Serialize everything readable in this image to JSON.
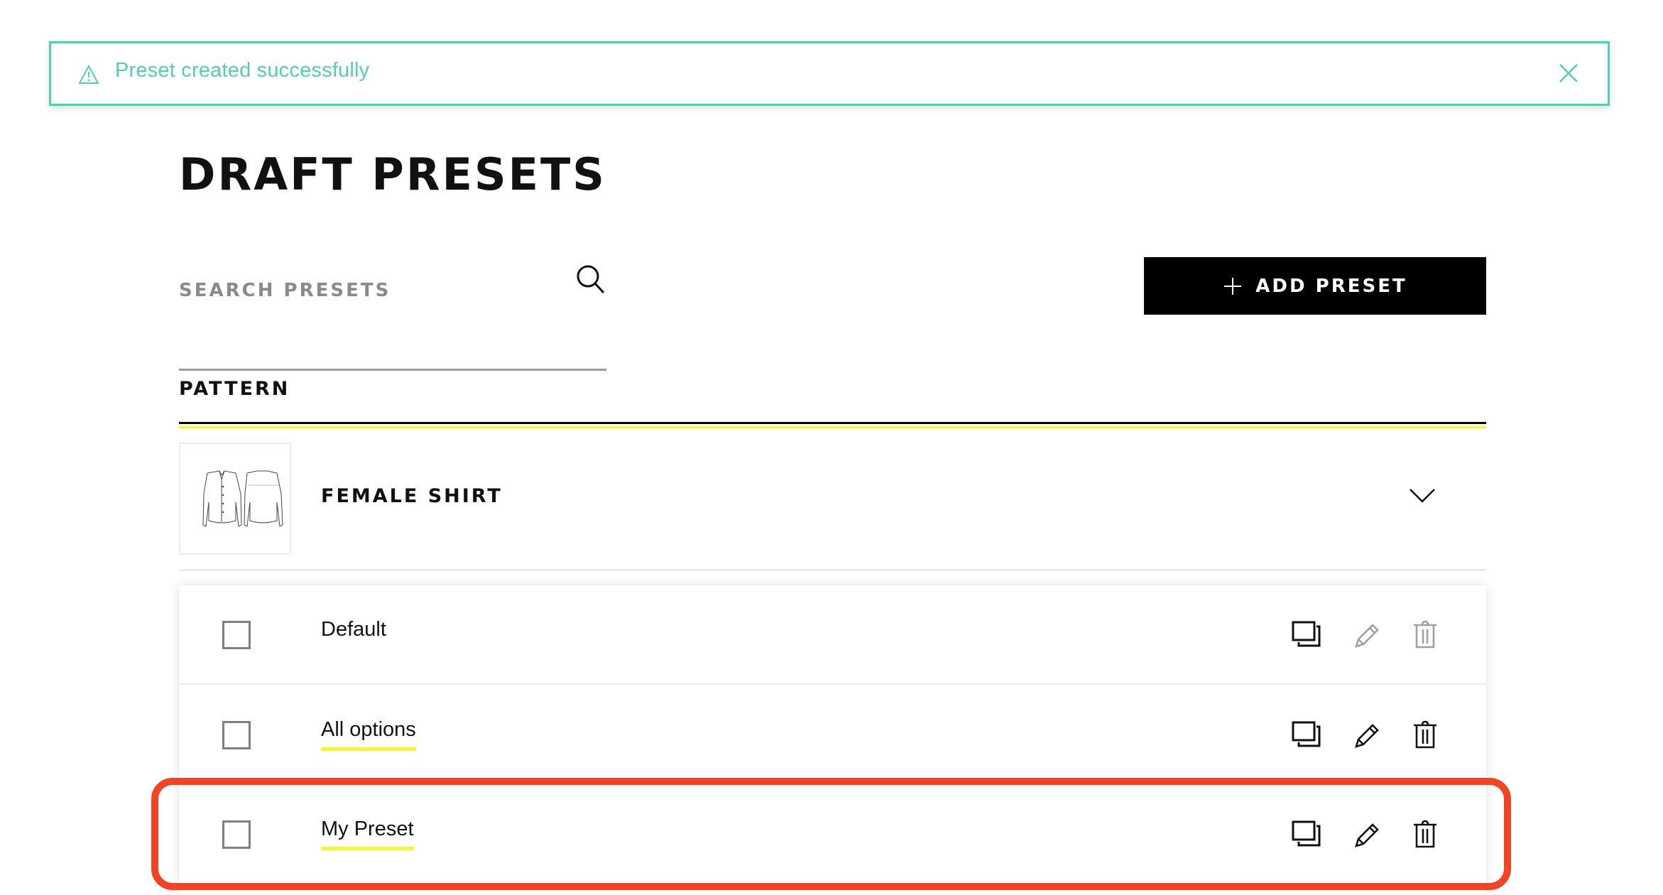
{
  "toast": {
    "message": "Preset created successfully",
    "icon": "warning-triangle-icon",
    "close_icon": "close-icon",
    "color": "#55cdaf"
  },
  "header": {
    "title": "DRAFT PRESETS"
  },
  "search": {
    "placeholder": "SEARCH PRESETS",
    "value": "",
    "icon": "search-icon"
  },
  "toolbar": {
    "add_label": "ADD PRESET",
    "add_icon": "plus-icon"
  },
  "section": {
    "label": "PATTERN",
    "accent_color": "#f4f34a"
  },
  "pattern": {
    "name": "FEMALE SHIRT",
    "thumbnail": "shirt-front-back-illustration",
    "expanded": true
  },
  "presets": [
    {
      "name": "Default",
      "checked": false,
      "editable": false,
      "deletable": false
    },
    {
      "name": "All options",
      "checked": false,
      "editable": true,
      "deletable": true
    },
    {
      "name": "My Preset",
      "checked": false,
      "editable": true,
      "deletable": true,
      "highlighted": true
    }
  ],
  "annotation": {
    "highlight_color": "#f24424"
  }
}
